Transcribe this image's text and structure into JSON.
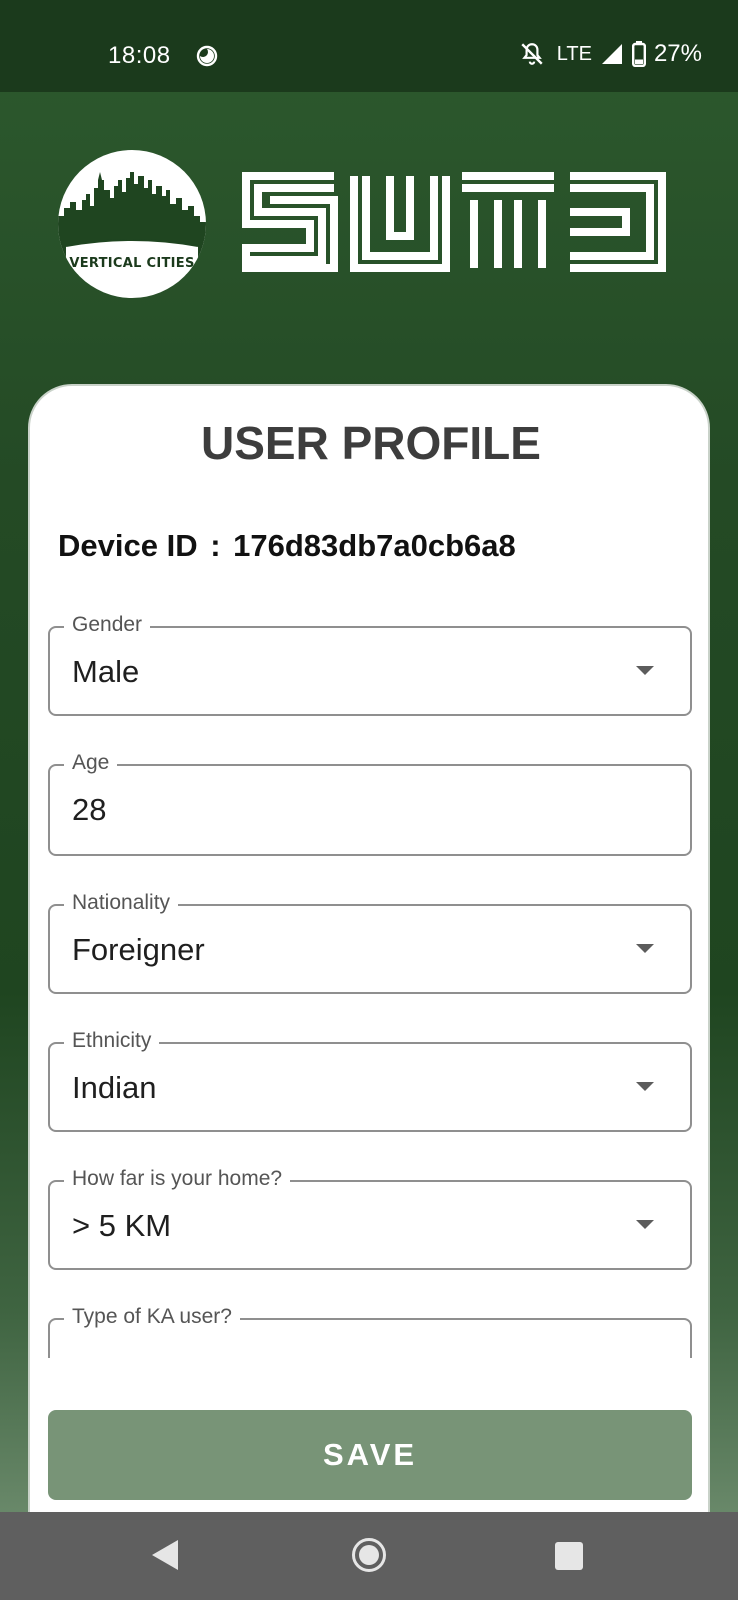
{
  "status_bar": {
    "time": "18:08",
    "network": "LTE",
    "battery": "27%"
  },
  "header": {
    "circle_logo_text": "VERTICAL CITIES",
    "brand_logo": "SUTD"
  },
  "card": {
    "title": "USER PROFILE",
    "device_id_label": "Device ID",
    "device_id_value": "176d83db7a0cb6a8"
  },
  "form": {
    "fields": [
      {
        "label": "Gender",
        "value": "Male",
        "type": "dropdown"
      },
      {
        "label": "Age",
        "value": "28",
        "type": "text"
      },
      {
        "label": "Nationality",
        "value": "Foreigner",
        "type": "dropdown"
      },
      {
        "label": "Ethnicity",
        "value": "Indian",
        "type": "dropdown"
      },
      {
        "label": "How far is your home?",
        "value": "> 5 KM",
        "type": "dropdown"
      },
      {
        "label": "Type of KA user?",
        "value": "",
        "type": "dropdown"
      }
    ],
    "save_label": "SAVE"
  },
  "colors": {
    "background": "#1f4520",
    "status_bar": "#1b3a1c",
    "save_button": "#789477",
    "nav_bar": "#5f5f5f"
  }
}
